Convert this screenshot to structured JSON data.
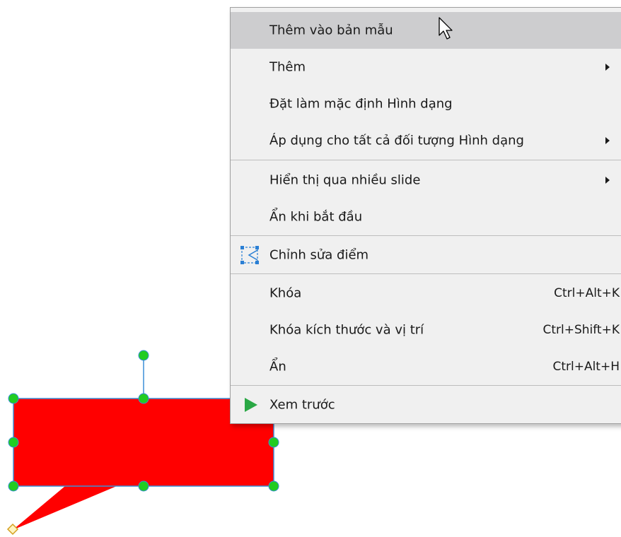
{
  "context_menu": {
    "items": [
      {
        "label": "Thêm vào bản mẫu",
        "shortcut": "",
        "submenu": false
      },
      {
        "label": "Thêm",
        "shortcut": "",
        "submenu": true
      },
      {
        "label": "Đặt làm mặc định Hình dạng",
        "shortcut": "",
        "submenu": false
      },
      {
        "label": "Áp dụng cho tất cả đối tượng Hình dạng",
        "shortcut": "",
        "submenu": true
      },
      {
        "label": "Hiển thị qua nhiều slide",
        "shortcut": "",
        "submenu": true
      },
      {
        "label": "Ẩn khi bắt đầu",
        "shortcut": "",
        "submenu": false
      },
      {
        "label": "Chỉnh sửa điểm",
        "shortcut": "",
        "submenu": false,
        "icon": "edit-points-icon"
      },
      {
        "label": "Khóa",
        "shortcut": "Ctrl+Alt+K",
        "submenu": false
      },
      {
        "label": "Khóa kích thước và vị trí",
        "shortcut": "Ctrl+Shift+K",
        "submenu": false
      },
      {
        "label": "Ẩn",
        "shortcut": "Ctrl+Alt+H",
        "submenu": false
      },
      {
        "label": "Xem trước",
        "shortcut": "",
        "submenu": false,
        "icon": "play-icon"
      }
    ],
    "highlighted_item": "Thêm vào bản mẫu"
  },
  "shape": {
    "type": "rectangular-callout",
    "fill_color": "#ff0000",
    "outline_color": "#3c8fd8",
    "handle_color": "#22cc22",
    "pointer_handle_color": "#f0c020",
    "selected": true
  },
  "cursor": {
    "icon": "arrow-cursor-icon"
  },
  "colors": {
    "menu_background": "#f0f0f0",
    "menu_highlight": "#cdcdcf",
    "menu_separator": "#bdbdbd",
    "play_icon": "#2aa845",
    "edit_points_icon": "#2a7fd4"
  }
}
